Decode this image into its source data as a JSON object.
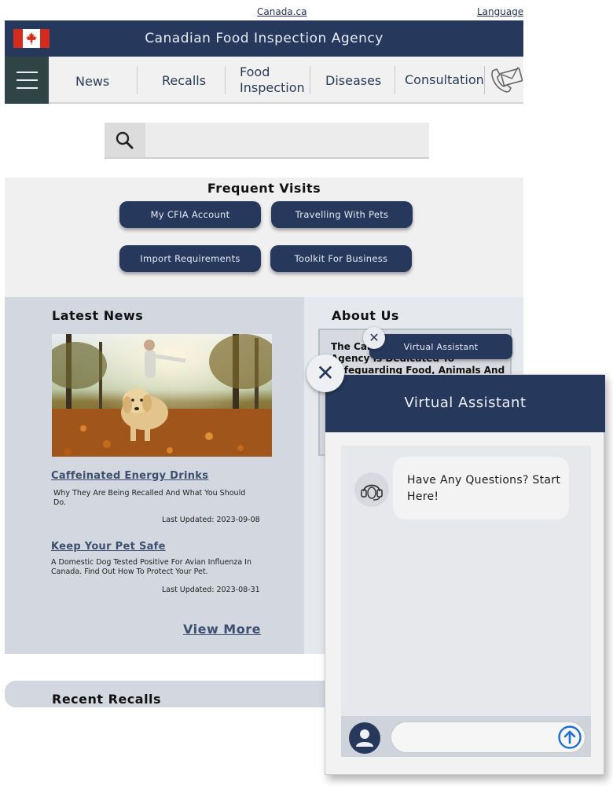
{
  "utility": {
    "canada_link": "Canada.ca",
    "language_link": "Language"
  },
  "header": {
    "title": "Canadian Food Inspection Agency"
  },
  "nav": {
    "items": [
      "News",
      "Recalls",
      "Food Inspection",
      "Diseases",
      "Consultation"
    ],
    "food_line1": "Food",
    "food_line2": "Inspection"
  },
  "search": {
    "placeholder": ""
  },
  "frequent_visits": {
    "title": "Frequent Visits",
    "buttons": [
      "My CFIA Account",
      "Travelling With Pets",
      "Import Requirements",
      "Toolkit For Business"
    ]
  },
  "latest_news": {
    "title": "Latest News",
    "items": [
      {
        "headline": "Caffeinated Energy Drinks",
        "summary": "Why They Are Being Recalled And What You Should Do.",
        "updated": "Last Updated: 2023-09-08"
      },
      {
        "headline": "Keep Your Pet Safe",
        "summary": "A Domestic Dog Tested Positive For Avian Influenza In Canada. Find Out How To Protect Your Pet.",
        "updated": "Last Updated: 2023-08-31"
      }
    ],
    "view_more": "View More"
  },
  "about": {
    "title": "About Us",
    "text": "The Canadian Food Inspection Agency Is Dedicated To Safeguarding Food, Animals And Plants"
  },
  "virtual_assistant": {
    "tab_label": "Virtual Assistant",
    "panel_title": "Virtual Assistant",
    "bot_message": "Have Any Questions? Start Here!",
    "input_placeholder": ""
  },
  "recent_recalls": {
    "title": "Recent Recalls"
  },
  "colors": {
    "navy": "#26395c",
    "nav_bg": "#f1f1f1",
    "news_bg": "#d3d8e0",
    "accent_blue": "#1f6fd1",
    "flag_red": "#d52b1e"
  },
  "icons": [
    "maple-leaf-icon",
    "hamburger-icon",
    "phone-mail-icon",
    "search-icon",
    "close-icon",
    "headset-icon",
    "user-icon",
    "send-arrow-icon"
  ]
}
